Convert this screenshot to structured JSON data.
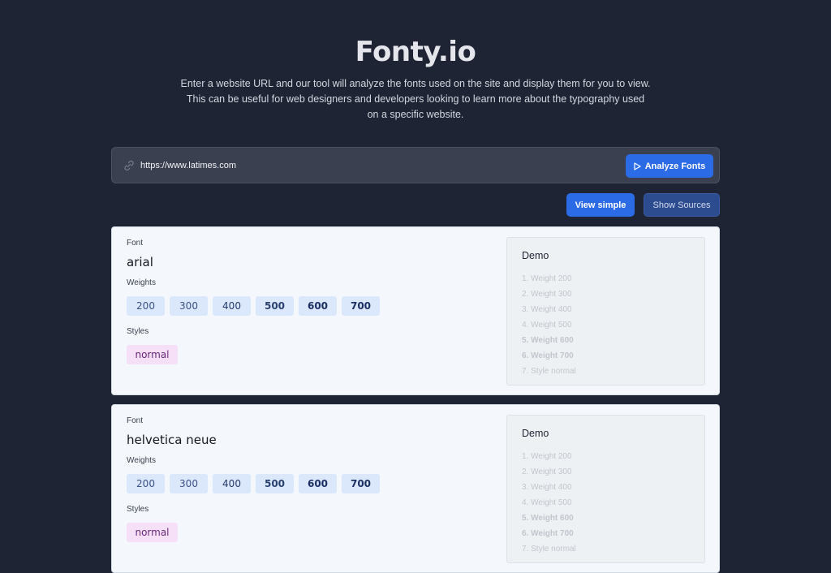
{
  "header": {
    "title": "Fonty.io",
    "description": "Enter a website URL and our tool will analyze the fonts used on the site and display them for you to view. This can be useful for web designers and developers looking to learn more about the typography used on a specific website."
  },
  "search": {
    "value": "https://www.latimes.com",
    "analyze_label": "Analyze Fonts"
  },
  "controls": {
    "view_simple_label": "View simple",
    "show_sources_label": "Show Sources"
  },
  "labels": {
    "font": "Font",
    "weights": "Weights",
    "styles": "Styles",
    "demo": "Demo"
  },
  "fonts": [
    {
      "name": "arial",
      "weights": [
        "200",
        "300",
        "400",
        "500",
        "600",
        "700"
      ],
      "styles": [
        "normal"
      ],
      "demo": [
        "1. Weight 200",
        "2. Weight 300",
        "3. Weight 400",
        "4. Weight 500",
        "5. Weight 600",
        "6. Weight 700",
        "7. Style normal"
      ]
    },
    {
      "name": "helvetica neue",
      "weights": [
        "200",
        "300",
        "400",
        "500",
        "600",
        "700"
      ],
      "styles": [
        "normal"
      ],
      "demo": [
        "1. Weight 200",
        "2. Weight 300",
        "3. Weight 400",
        "4. Weight 500",
        "5. Weight 600",
        "6. Weight 700",
        "7. Style normal"
      ]
    }
  ],
  "colors": {
    "background": "#1e2433",
    "accent": "#2b6be6",
    "card": "#f4f8fd"
  }
}
